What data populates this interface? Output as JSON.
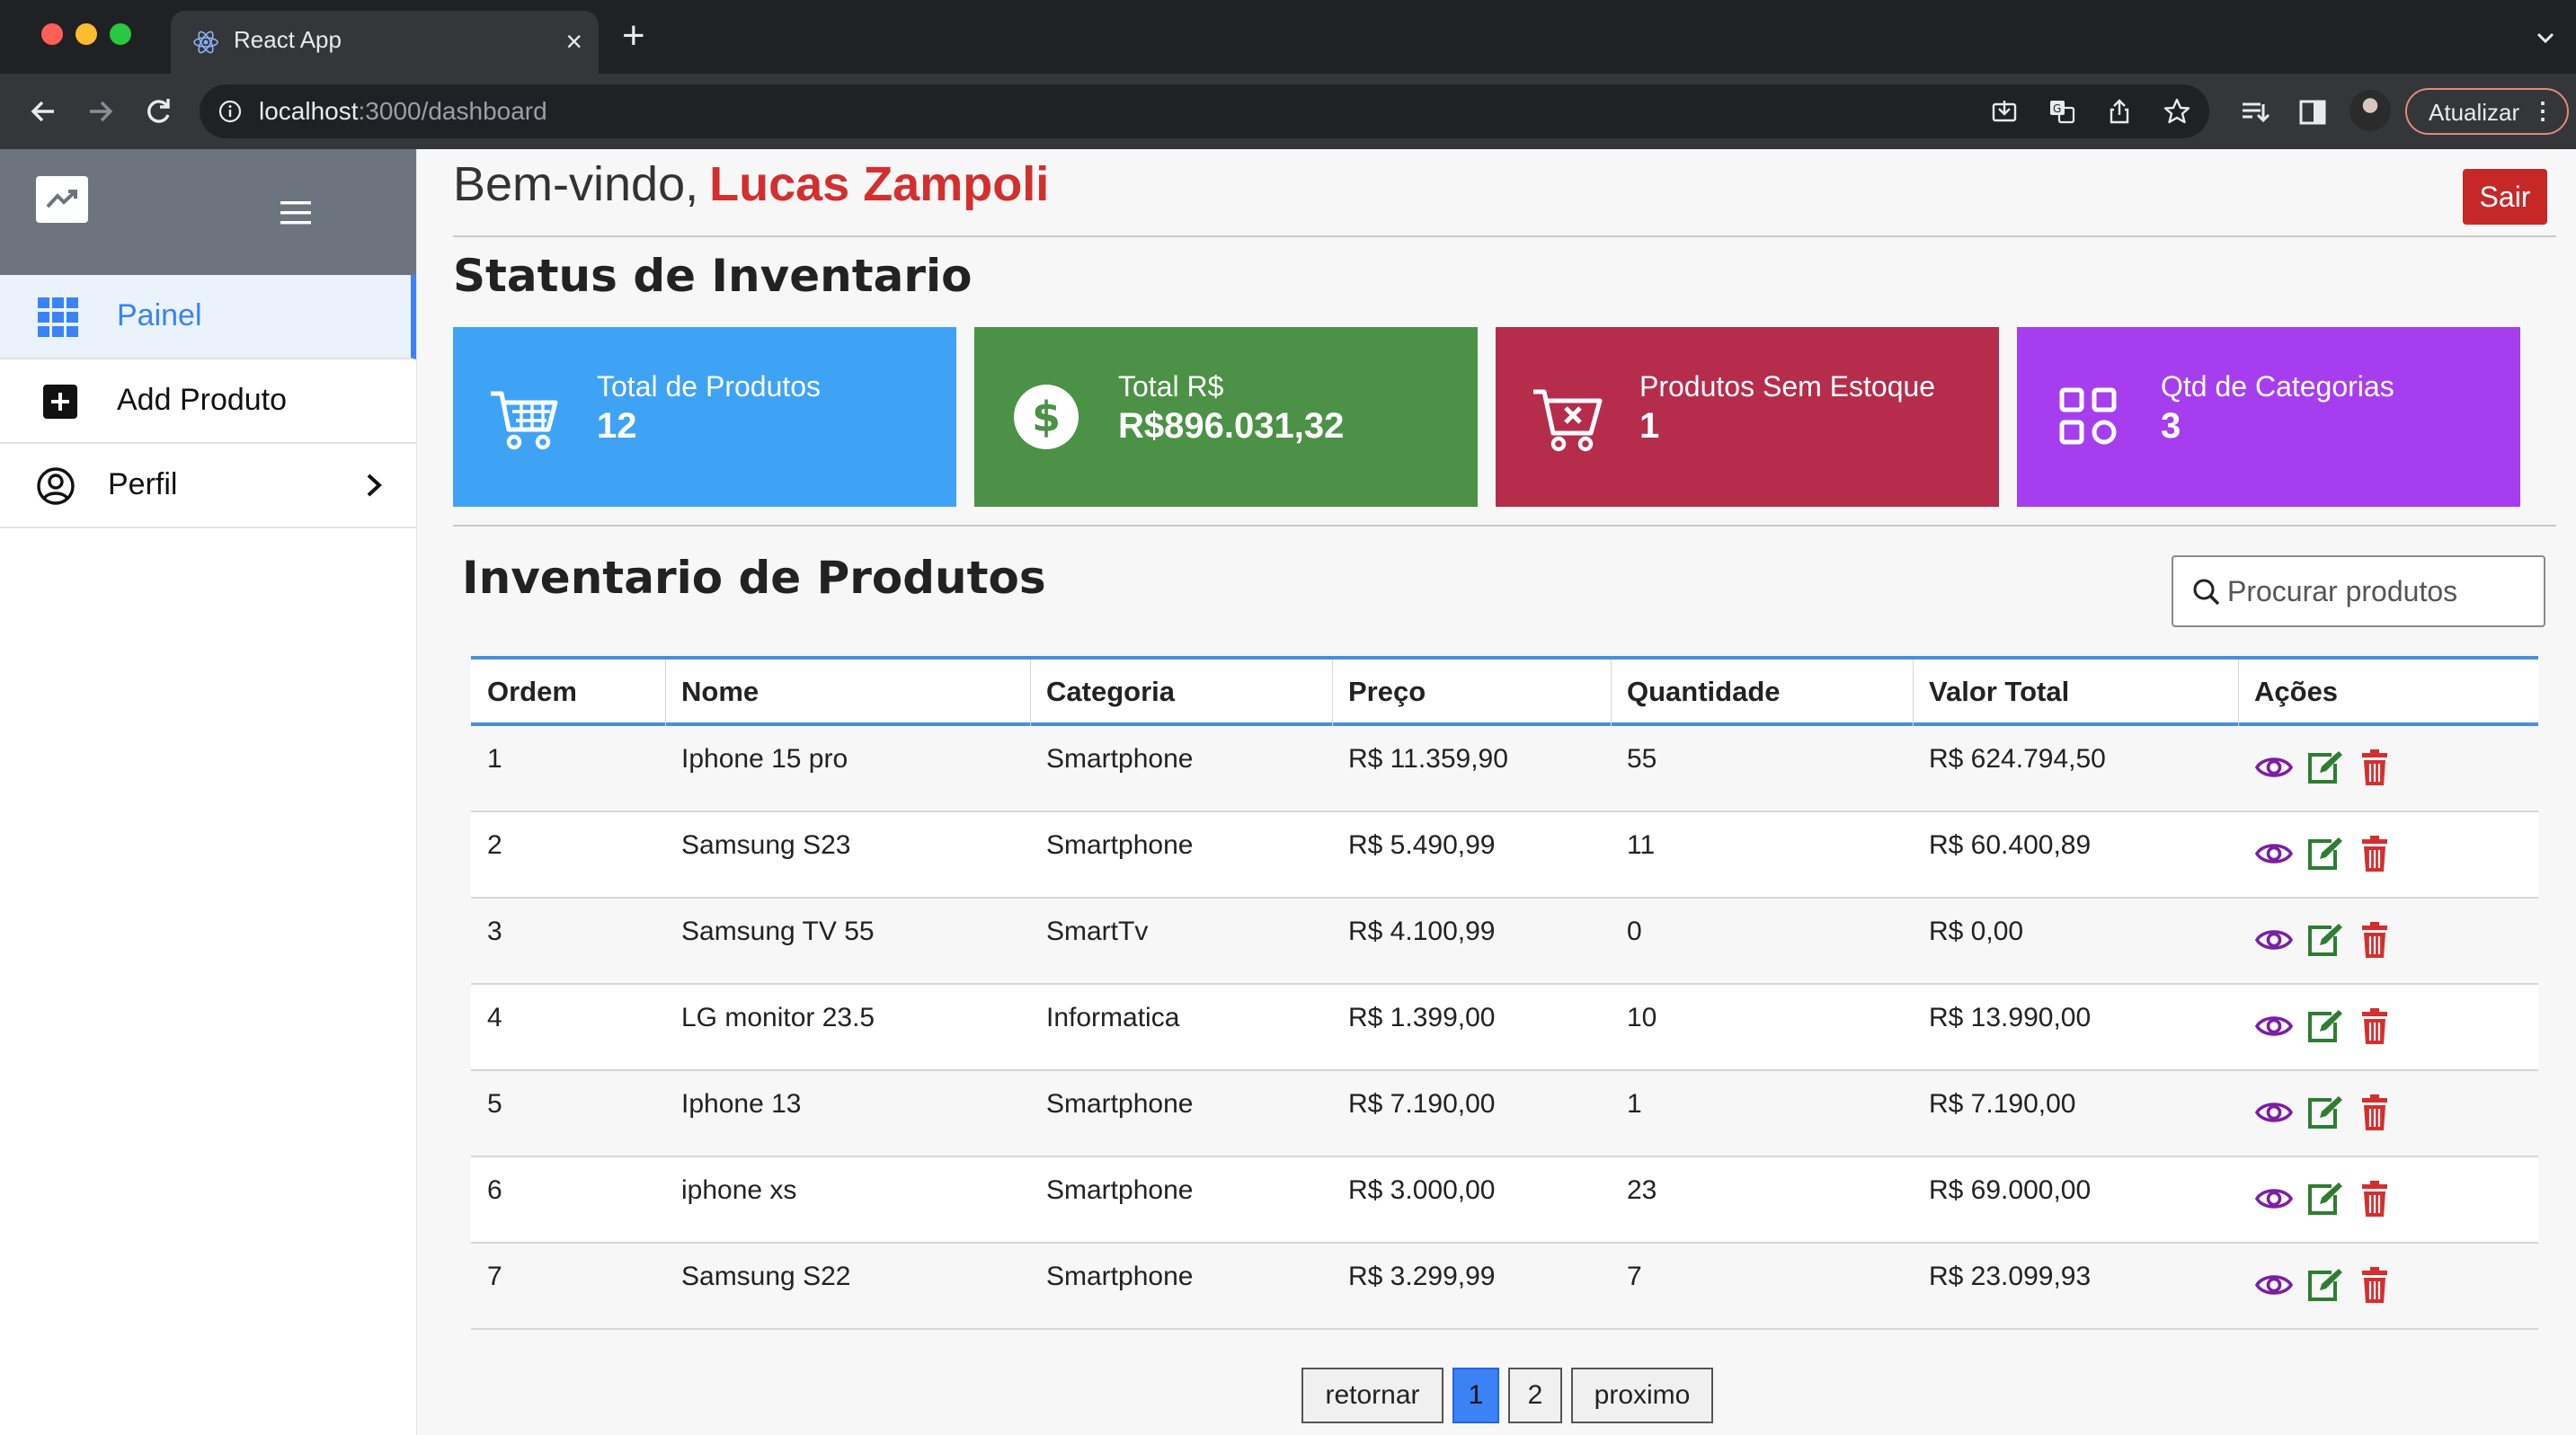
{
  "browser": {
    "tab_title": "React App",
    "tab_close": "×",
    "new_tab": "+",
    "url_host": "localhost",
    "url_path": ":3000/dashboard",
    "update_label": "Atualizar",
    "update_dots": "⋮"
  },
  "sidebar": {
    "items": [
      {
        "label": "Painel",
        "icon": "grid-icon",
        "active": true
      },
      {
        "label": "Add Produto",
        "icon": "plus-square-icon"
      },
      {
        "label": "Perfil",
        "icon": "user-circle-icon"
      }
    ]
  },
  "header": {
    "welcome": "Bem-vindo,",
    "user_name": "Lucas Zampoli",
    "logout": "Sair"
  },
  "status": {
    "title": "Status de Inventario",
    "cards": [
      {
        "label": "Total de Produtos",
        "value": "12",
        "color": "#3fa3f5",
        "icon": "cart-icon"
      },
      {
        "label": "Total R$",
        "value": "R$896.031,32",
        "color": "#4b9246",
        "icon": "dollar-icon"
      },
      {
        "label": "Produtos Sem Estoque",
        "value": "1",
        "color": "#b52d4a",
        "icon": "cart-remove-icon"
      },
      {
        "label": "Qtd de Categorias",
        "value": "3",
        "color": "#a63ef0",
        "icon": "categories-icon"
      }
    ]
  },
  "inventory": {
    "title": "Inventario de Produtos",
    "search_placeholder": "Procurar produtos",
    "columns": [
      "Ordem",
      "Nome",
      "Categoria",
      "Preço",
      "Quantidade",
      "Valor Total",
      "Ações"
    ],
    "rows": [
      [
        "1",
        "Iphone 15 pro",
        "Smartphone",
        "R$ 11.359,90",
        "55",
        "R$ 624.794,50"
      ],
      [
        "2",
        "Samsung S23",
        "Smartphone",
        "R$ 5.490,99",
        "11",
        "R$ 60.400,89"
      ],
      [
        "3",
        "Samsung TV 55",
        "SmartTv",
        "R$ 4.100,99",
        "0",
        "R$ 0,00"
      ],
      [
        "4",
        "LG monitor 23.5",
        "Informatica",
        "R$ 1.399,00",
        "10",
        "R$ 13.990,00"
      ],
      [
        "5",
        "Iphone 13",
        "Smartphone",
        "R$ 7.190,00",
        "1",
        "R$ 7.190,00"
      ],
      [
        "6",
        "iphone xs",
        "Smartphone",
        "R$ 3.000,00",
        "23",
        "R$ 69.000,00"
      ],
      [
        "7",
        "Samsung S22",
        "Smartphone",
        "R$ 3.299,99",
        "7",
        "R$ 23.099,93"
      ]
    ],
    "action_icons": [
      "eye-icon",
      "edit-icon",
      "trash-icon"
    ],
    "action_colors": {
      "view": "#7b1fa2",
      "edit": "#2e7d32",
      "delete": "#d32f2f"
    }
  },
  "pagination": {
    "prev": "retornar",
    "pages": [
      "1",
      "2"
    ],
    "current": "1",
    "next": "proximo"
  }
}
